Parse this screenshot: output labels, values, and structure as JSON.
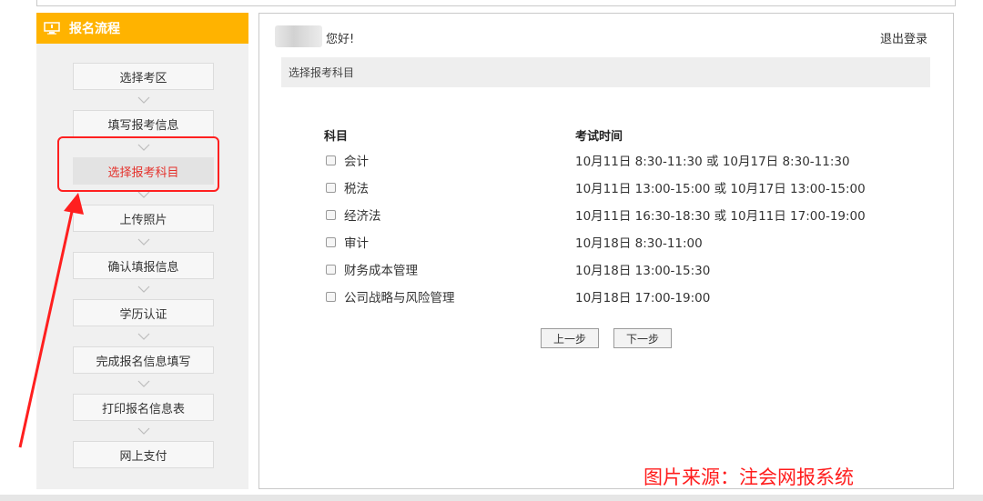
{
  "sidebar": {
    "title": "报名流程",
    "steps": [
      {
        "label": "选择考区"
      },
      {
        "label": "填写报考信息"
      },
      {
        "label": "选择报考科目"
      },
      {
        "label": "上传照片"
      },
      {
        "label": "确认填报信息"
      },
      {
        "label": "学历认证"
      },
      {
        "label": "完成报名信息填写"
      },
      {
        "label": "打印报名信息表"
      },
      {
        "label": "网上支付"
      }
    ],
    "active_index": 2
  },
  "header": {
    "greeting": "您好!",
    "logout": "退出登录"
  },
  "section_title": "选择报考科目",
  "table": {
    "col_subject": "科目",
    "col_time": "考试时间",
    "rows": [
      {
        "subject": "会计",
        "time": "10月11日   8:30-11:30 或 10月17日   8:30-11:30"
      },
      {
        "subject": "税法",
        "time": "10月11日 13:00-15:00 或 10月17日 13:00-15:00"
      },
      {
        "subject": "经济法",
        "time": "10月11日 16:30-18:30 或 10月11日 17:00-19:00"
      },
      {
        "subject": "审计",
        "time": "10月18日   8:30-11:00"
      },
      {
        "subject": "财务成本管理",
        "time": "10月18日 13:00-15:30"
      },
      {
        "subject": "公司战略与风险管理",
        "time": "10月18日 17:00-19:00"
      }
    ]
  },
  "buttons": {
    "prev": "上一步",
    "next": "下一步"
  },
  "source_caption": "图片来源：注会网报系统",
  "colors": {
    "sidebar_header": "#ffb300",
    "active_text": "#e5322c",
    "annotation": "#ff2020"
  }
}
